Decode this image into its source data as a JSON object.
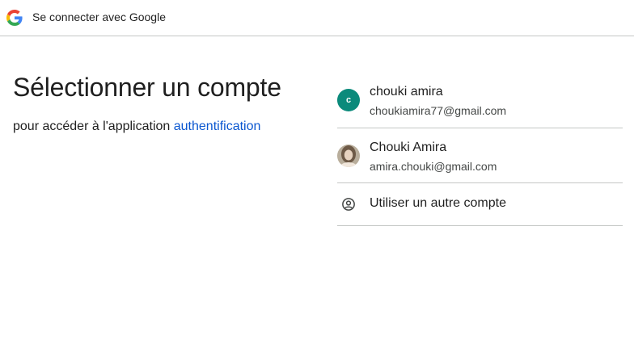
{
  "header": {
    "title": "Se connecter avec Google",
    "logo_icon": "google-g-icon"
  },
  "main": {
    "heading": "Sélectionner un compte",
    "subtitle_prefix": "pour accéder à l'application",
    "app_link": "authentification"
  },
  "accounts": [
    {
      "name": "chouki amira",
      "email": "choukiamira77@gmail.com",
      "avatar_letter": "c",
      "avatar_color": "#0b8a7b"
    },
    {
      "name": "Chouki Amira",
      "email": "amira.chouki@gmail.com",
      "avatar_icon": "profile-photo"
    }
  ],
  "other_account": {
    "label": "Utiliser un autre compte",
    "icon": "account-circle-icon"
  },
  "colors": {
    "link": "#0b57d0",
    "divider": "#c4c7c5",
    "text": "#1f1f1f",
    "secondary_text": "#444746"
  }
}
